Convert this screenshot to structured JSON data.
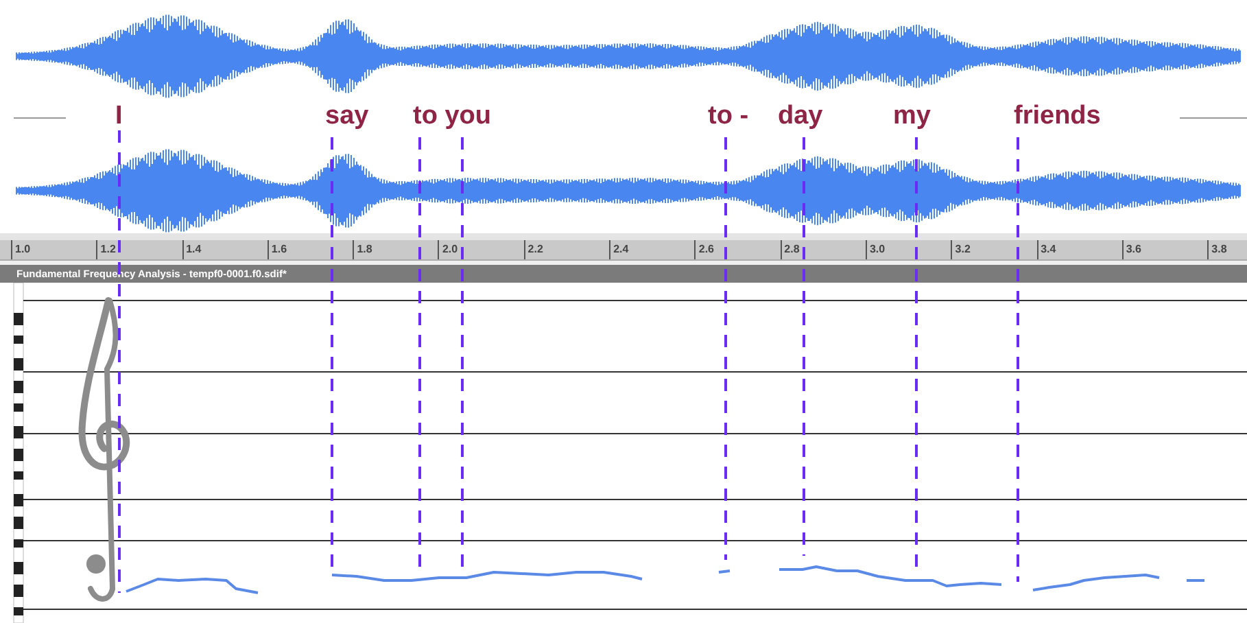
{
  "words": [
    {
      "text": "I"
    },
    {
      "text": "say"
    },
    {
      "text": "to you"
    },
    {
      "text": "to -"
    },
    {
      "text": "day"
    },
    {
      "text": "my"
    },
    {
      "text": "friends"
    }
  ],
  "ruler": {
    "ticks": [
      "1.0",
      "1.2",
      "1.4",
      "1.6",
      "1.8",
      "2.0",
      "2.2",
      "2.4",
      "2.6",
      "2.8",
      "3.0",
      "3.2",
      "3.4",
      "3.6",
      "3.8"
    ]
  },
  "panel": {
    "title": "Fundamental Frequency Analysis - tempf0-0001.f0.sdif*"
  }
}
